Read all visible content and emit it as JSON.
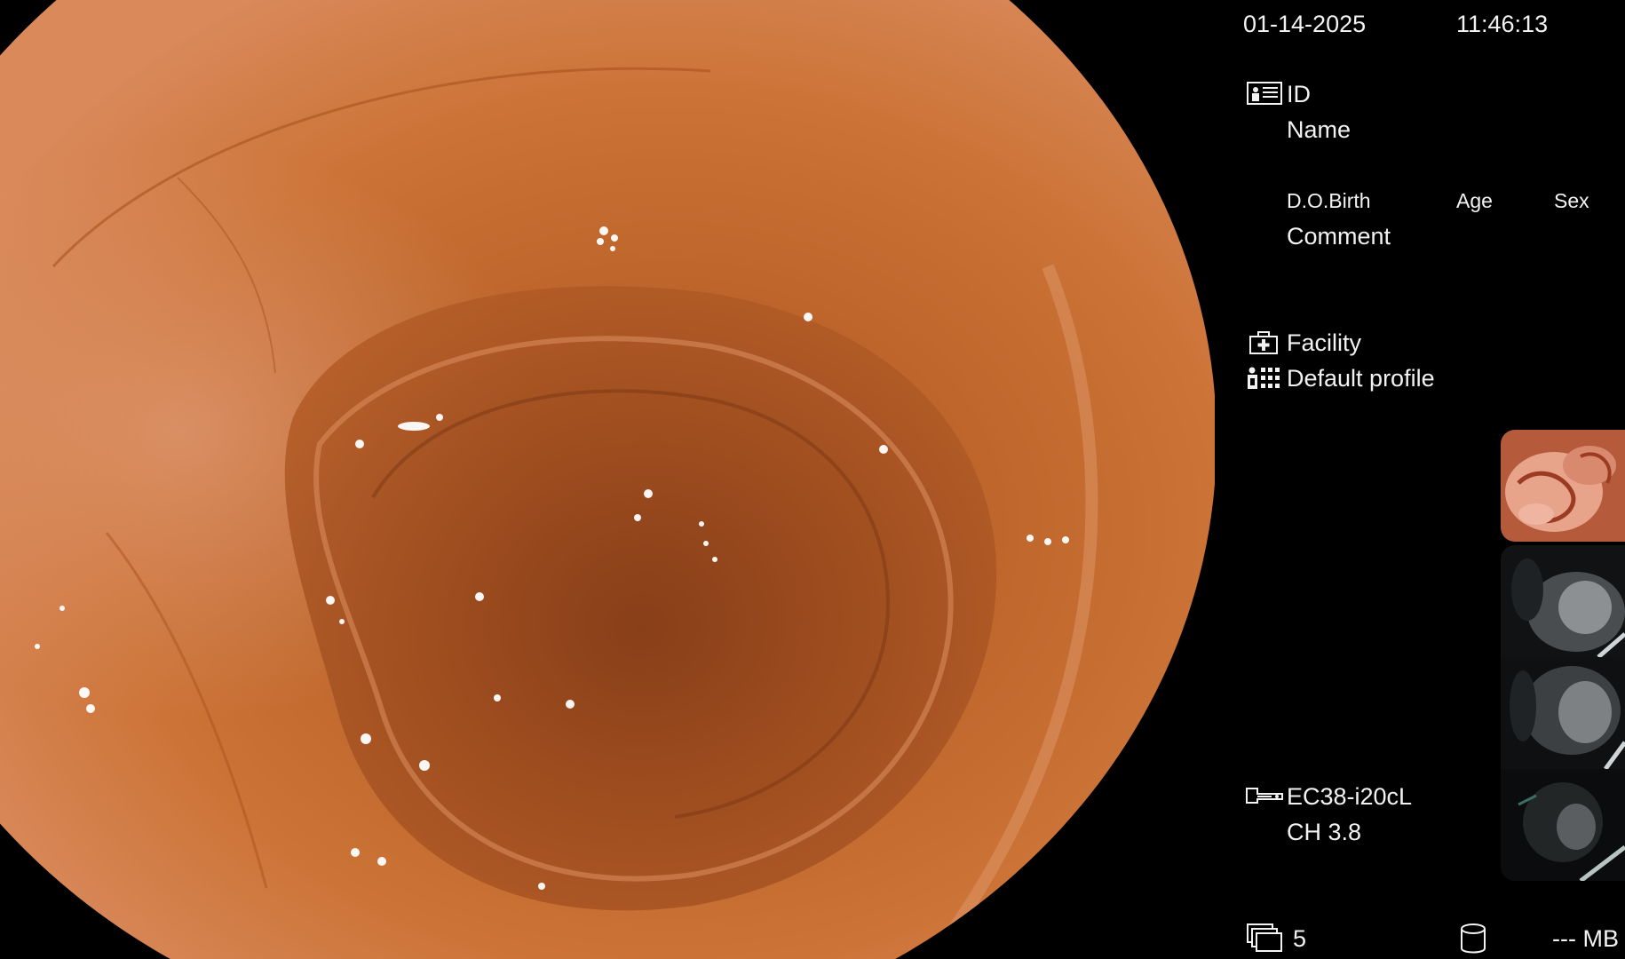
{
  "header": {
    "date": "01-14-2025",
    "time": "11:46:13"
  },
  "patient": {
    "id_label": "ID",
    "name_label": "Name",
    "dob_label": "D.O.Birth",
    "age_label": "Age",
    "sex_label": "Sex",
    "comment_label": "Comment"
  },
  "facility": {
    "facility_label": "Facility",
    "profile_label": "Default profile"
  },
  "scope": {
    "model": "EC38-i20cL",
    "channel": "CH 3.8"
  },
  "footer": {
    "image_count": "5",
    "storage": "--- MB"
  },
  "icons": [
    "patient-id-card-icon",
    "facility-icon",
    "profile-icon",
    "endoscope-icon",
    "image-stack-icon",
    "storage-cylinder-icon"
  ],
  "thumbnails": [
    "colon-thumbnail",
    "scope-thumbnail",
    "scope-thumbnail",
    "scope-thumbnail"
  ],
  "colors": {
    "background": "#000000",
    "text": "#f2f2f2",
    "mucosa": "#c4682f",
    "lumen": "#8a3f1a"
  }
}
